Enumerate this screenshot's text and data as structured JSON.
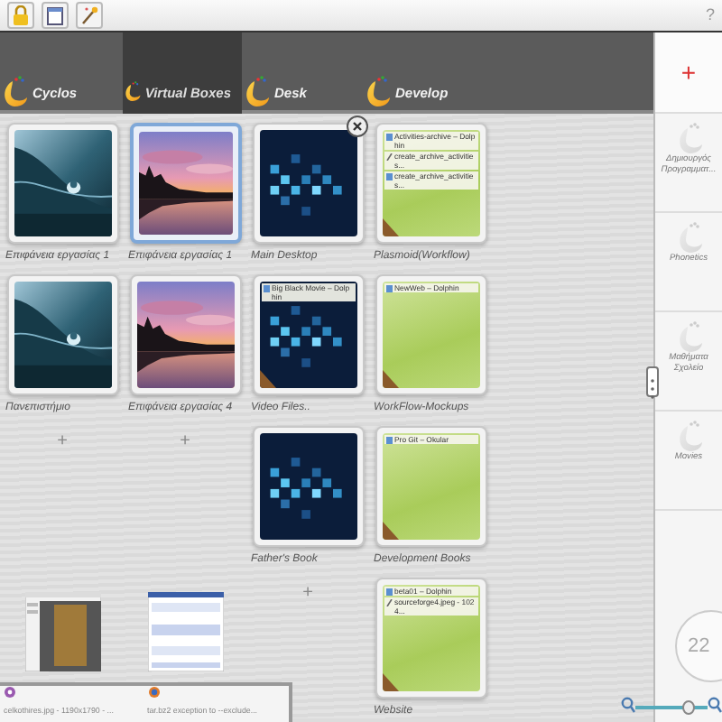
{
  "top_bar": {
    "help": "?"
  },
  "tabs": [
    {
      "label": "Cyclos",
      "selected": false
    },
    {
      "label": "Virtual Boxes",
      "selected": true
    },
    {
      "label": "Desk",
      "selected": false
    },
    {
      "label": "Develop",
      "selected": false
    }
  ],
  "new_activity": "+",
  "grid": {
    "rows": [
      [
        {
          "label": "Επιφάνεια εργασίας 1",
          "selected": false,
          "hovered": false
        },
        {
          "label": "Επιφάνεια εργασίας 1",
          "selected": true,
          "hovered": false
        },
        {
          "label": "Main Desktop",
          "selected": false,
          "hovered": true
        },
        {
          "kind": "plain",
          "label": "Plasmoid(Workflow)",
          "selected": false,
          "hovered": false,
          "windows": [
            "Activities-archive – Dolphin",
            "create_archive_activities...",
            "create_archive_activities..."
          ]
        }
      ],
      [
        {
          "label": "Πανεπιστήμιο",
          "selected": false,
          "hovered": false
        },
        {
          "label": "Επιφάνεια εργασίας 4",
          "selected": false,
          "hovered": false
        },
        {
          "label": "Video Files..",
          "selected": false,
          "hovered": false,
          "windows": [
            "Big Black Movie – Dolphin"
          ]
        },
        {
          "kind": "plain",
          "label": "WorkFlow-Mockups",
          "selected": false,
          "hovered": false,
          "windows": [
            "NewWeb – Dolphin"
          ]
        }
      ],
      [
        {
          "kind": "add",
          "label": "+"
        },
        {
          "kind": "add",
          "label": "+"
        },
        {
          "label": "Father's Book",
          "selected": false,
          "hovered": false
        },
        {
          "kind": "plain",
          "label": "Development Books",
          "selected": false,
          "hovered": false,
          "windows": [
            "Pro Git – Okular"
          ]
        }
      ],
      [
        {
          "kind": "window"
        },
        {
          "kind": "window"
        },
        {
          "kind": "add",
          "label": "+"
        },
        {
          "kind": "plain",
          "label": "Website",
          "selected": false,
          "hovered": false,
          "windows": [
            "beta01 – Dolphin",
            "sourceforge4.jpeg - 1024..."
          ]
        }
      ]
    ]
  },
  "taskbar": [
    {
      "title": "celkothires.jpg - 1190x1790 - ..."
    },
    {
      "title": "tar.bz2 exception to --exclude..."
    }
  ],
  "sidebar": {
    "activities": [
      {
        "label": "Δημιουργός Προγραμματ..."
      },
      {
        "label": "Phonetics"
      },
      {
        "label": "Μαθήματα Σχολείο"
      },
      {
        "label": "Movies"
      }
    ]
  },
  "clock": {
    "time": "22"
  },
  "zoom_slider": {
    "level": 0.72
  }
}
